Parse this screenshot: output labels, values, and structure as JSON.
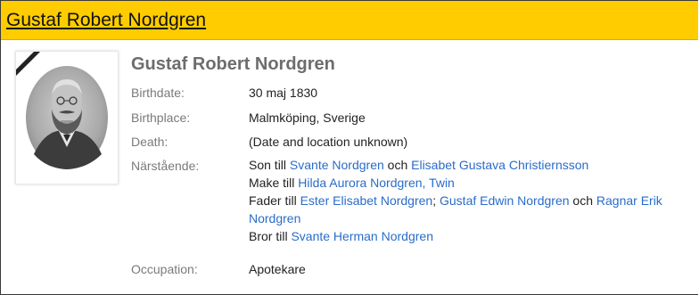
{
  "header": {
    "title": "Gustaf Robert Nordgren"
  },
  "profile": {
    "name": "Gustaf Robert Nordgren"
  },
  "fields": {
    "birthdate_label": "Birthdate:",
    "birthdate": "30 maj 1830",
    "birthplace_label": "Birthplace:",
    "birthplace": "Malmköping, Sverige",
    "death_label": "Death:",
    "death": "(Date and location unknown)",
    "relatives_label": "Närstående:",
    "occupation_label": "Occupation:",
    "occupation": "Apotekare"
  },
  "relatives": {
    "son_prefix": "Son till ",
    "father_name": "Svante Nordgren",
    "son_and": " och ",
    "mother_name": "Elisabet Gustava Christiernsson",
    "husband_prefix": "Make till ",
    "wife_name": "Hilda Aurora Nordgren, Twin",
    "father_prefix": "Fader till ",
    "child1": "Ester Elisabet Nordgren",
    "sep1": "; ",
    "child2": "Gustaf Edwin Nordgren",
    "father_and": " och ",
    "child3_part1": "Ragnar Erik",
    "child3_part2": "Nordgren",
    "brother_prefix": "Bror till ",
    "brother_name": "Svante Herman Nordgren"
  }
}
